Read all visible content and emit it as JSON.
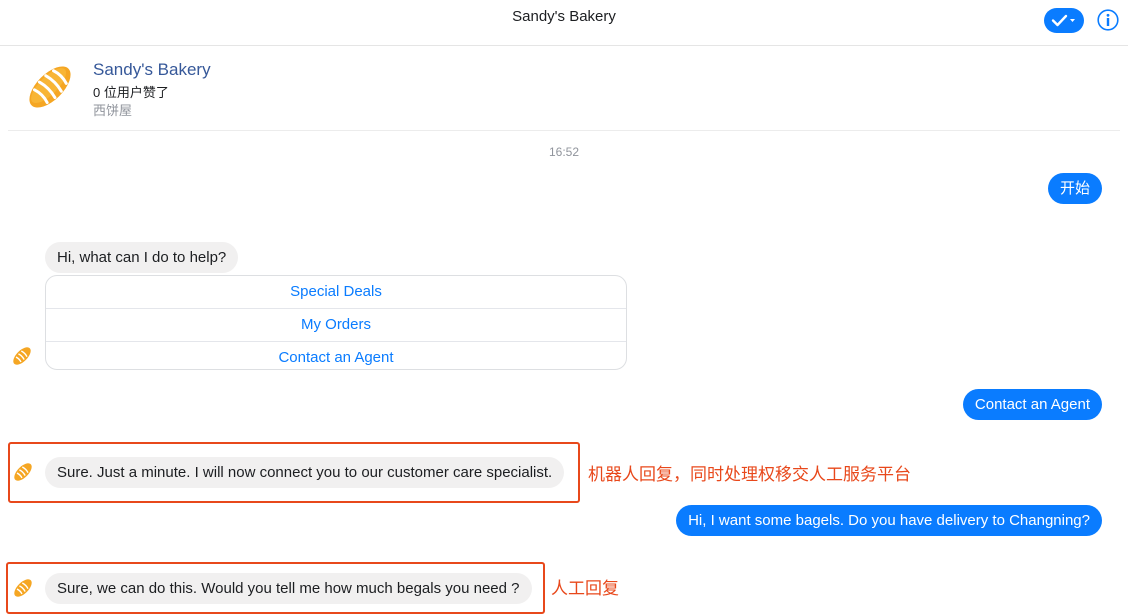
{
  "header": {
    "title": "Sandy's Bakery"
  },
  "profile": {
    "name": "Sandy's Bakery",
    "likes": "0 位用户赞了",
    "category": "西饼屋"
  },
  "conversation": {
    "timestamp": "16:52",
    "messages": [
      {
        "from": "user",
        "text": "开始"
      },
      {
        "from": "bot",
        "text": "Hi, what can I do to help?"
      },
      {
        "from": "user",
        "text": "Contact an Agent"
      },
      {
        "from": "bot",
        "text": "Sure.  Just a minute. I will now connect you to our customer care specialist."
      },
      {
        "from": "user",
        "text": "Hi, I want some bagels. Do you have delivery to Changning?"
      },
      {
        "from": "agent",
        "text": "Sure, we can do this. Would you tell me how much begals you need ?"
      }
    ],
    "quick_replies": [
      "Special Deals",
      "My Orders",
      "Contact an Agent"
    ]
  },
  "annotations": {
    "bot_reply": "机器人回复，同时处理权移交人工服务平台",
    "human_reply": "人工回复"
  },
  "colors": {
    "accent": "#0a7cff",
    "incoming_bubble": "#f1f0f0",
    "annotation": "#e8481b",
    "brand_link": "#365899"
  },
  "icons": [
    "check-icon",
    "dropdown-caret-icon",
    "info-icon",
    "bread-logo-icon",
    "bread-avatar-icon"
  ]
}
